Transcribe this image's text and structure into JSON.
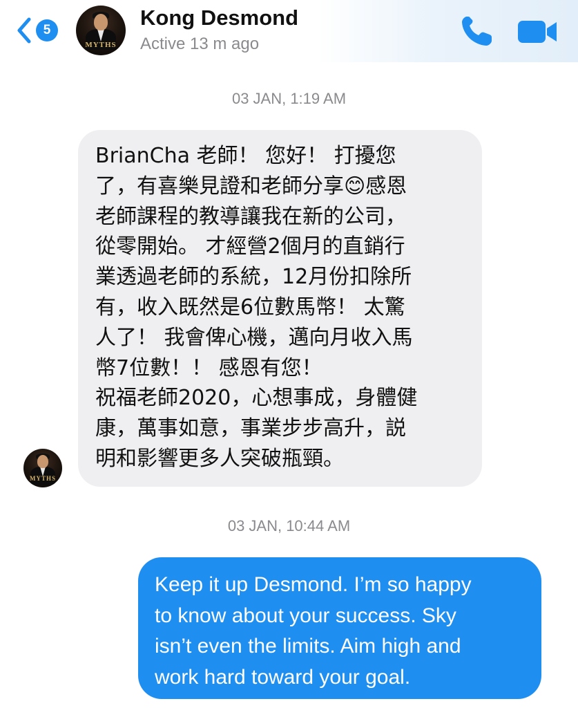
{
  "header": {
    "back_badge": "5",
    "contact_name": "Kong Desmond",
    "status": "Active 13 m ago",
    "avatar_logo": "MYTHS"
  },
  "icons": {
    "back": "chevron-left-icon",
    "call": "phone-icon",
    "video": "video-camera-icon"
  },
  "colors": {
    "accent": "#1f8ef1",
    "incoming_bubble": "#efeff1",
    "timestamp": "#8a8a8e"
  },
  "messages": [
    {
      "timestamp": "03 JAN, 1:19 AM",
      "direction": "incoming",
      "text": "BrianCha 老師！ 您好！ 打擾您\n了，有喜樂見證和老師分享😊感恩\n老師課程的教導讓我在新的公司，\n從零開始。 才經營2個月的直銷行\n業透過老師的系統，12月份扣除所\n有，收入既然是6位數馬幣！ 太驚\n人了！ 我會俾心機，邁向月收入馬\n幣7位數！！ 感恩有您！\n祝福老師2020，心想事成，身體健\n康，萬事如意，事業步步高升，説\n明和影響更多人突破瓶頸。"
    },
    {
      "timestamp": "03 JAN, 10:44 AM",
      "direction": "outgoing",
      "text": "Keep it up Desmond. I’m so happy\nto know about your success. Sky\nisn’t even the limits. Aim high and\nwork hard toward your goal."
    }
  ]
}
